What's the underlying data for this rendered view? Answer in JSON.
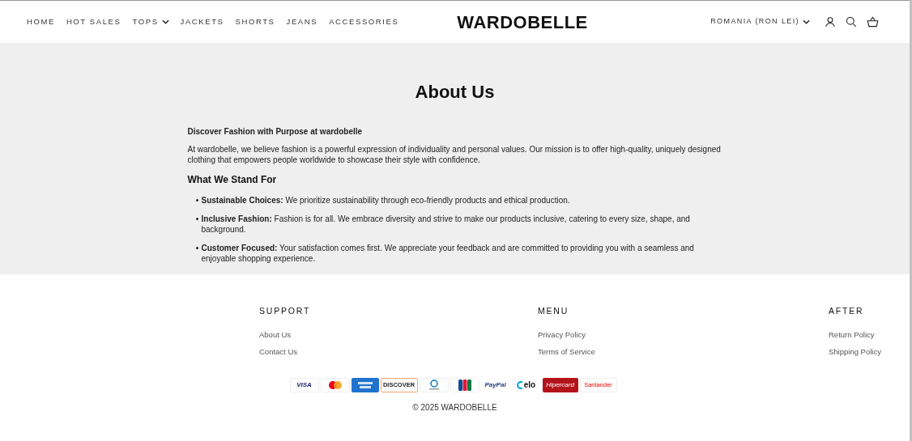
{
  "header": {
    "nav": [
      {
        "label": "HOME",
        "has_dropdown": false
      },
      {
        "label": "HOT SALES",
        "has_dropdown": false
      },
      {
        "label": "TOPS",
        "has_dropdown": true
      },
      {
        "label": "JACKETS",
        "has_dropdown": false
      },
      {
        "label": "SHORTS",
        "has_dropdown": false
      },
      {
        "label": "JEANS",
        "has_dropdown": false
      },
      {
        "label": "ACCESSORIES",
        "has_dropdown": false
      }
    ],
    "logo": "WARDOBELLE",
    "country": "ROMANIA (RON LEI)"
  },
  "main": {
    "title": "About Us",
    "intro_heading": "Discover Fashion with Purpose at wardobelle",
    "intro": "At wardobelle, we believe fashion is a powerful expression of individuality and personal values. Our mission is to offer high-quality, uniquely designed clothing that empowers people worldwide to showcase their style with confidence.",
    "section_heading": "What We Stand For",
    "points": [
      "**Sustainable Choices:** We prioritize sustainability through eco-friendly products and ethical production.",
      "**Inclusive Fashion:** Fashion is for all. We embrace diversity and strive to make our products inclusive, catering to every size, shape, and background.",
      "**Customer Focused:** Your satisfaction comes first. We appreciate your feedback and are committed to providing you with a seamless and enjoyable shopping experience."
    ]
  },
  "footer": {
    "columns": [
      {
        "title": "SUPPORT",
        "links": [
          "About Us",
          "Contact Us"
        ]
      },
      {
        "title": "MENU",
        "links": [
          "Privacy Policy",
          "Terms of Service"
        ]
      },
      {
        "title": "AFTER",
        "links": [
          "Return Policy",
          "Shipping Policy"
        ]
      }
    ],
    "payment_methods": [
      {
        "kind": "visa",
        "label": "VISA"
      },
      {
        "kind": "mastercard"
      },
      {
        "kind": "amex"
      },
      {
        "kind": "discover",
        "label": "DISCOVER"
      },
      {
        "kind": "diners"
      },
      {
        "kind": "jcb"
      },
      {
        "kind": "paypal",
        "label": "PayPal"
      },
      {
        "kind": "elo",
        "label": "elo"
      },
      {
        "kind": "hipercard",
        "label": "Hipercard"
      },
      {
        "kind": "santander",
        "label": "Santander"
      }
    ],
    "copyright": "© 2025 WARDOBELLE"
  }
}
